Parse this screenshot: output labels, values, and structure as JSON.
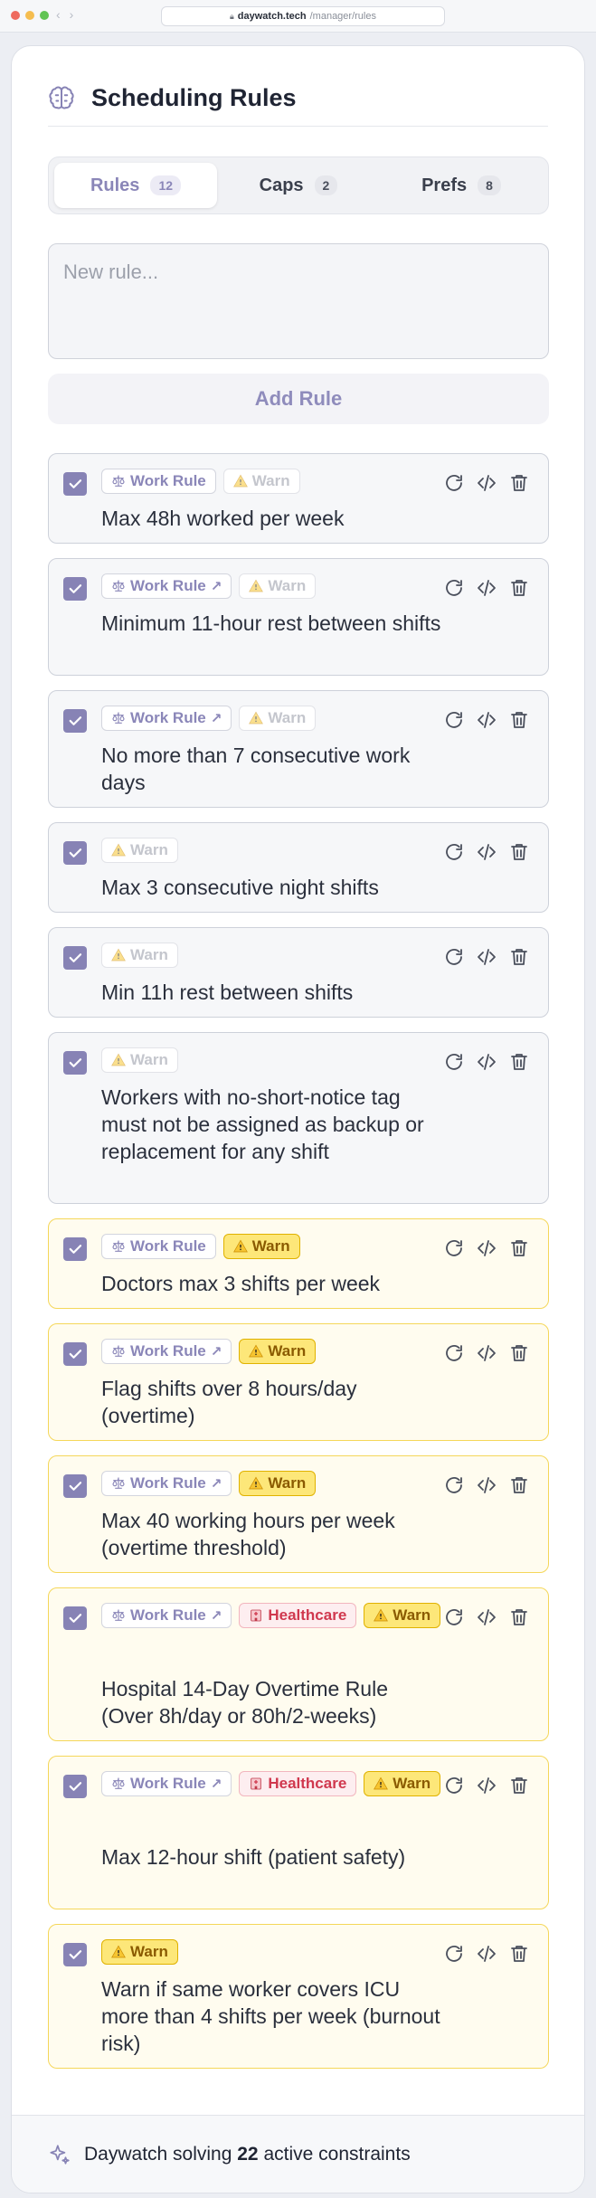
{
  "browser": {
    "domain": "daywatch.tech",
    "path": "/manager/rules"
  },
  "page": {
    "title": "Scheduling Rules",
    "icon": "brain-icon"
  },
  "tabs": [
    {
      "label": "Rules",
      "count": "12",
      "active": true
    },
    {
      "label": "Caps",
      "count": "2",
      "active": false
    },
    {
      "label": "Prefs",
      "count": "8",
      "active": false
    }
  ],
  "new_rule": {
    "placeholder": "New rule...",
    "add_label": "Add Rule"
  },
  "tag_labels": {
    "work": "Work Rule",
    "warn": "Warn",
    "health": "Healthcare"
  },
  "rules": [
    {
      "text": "Max 48h worked per week",
      "checked": true,
      "work": true,
      "ext": false,
      "health": false,
      "warn": "faint"
    },
    {
      "text": "Minimum 11-hour rest between shifts",
      "checked": true,
      "work": true,
      "ext": true,
      "health": false,
      "warn": "faint"
    },
    {
      "text": "No more than 7 consecutive work days",
      "checked": true,
      "work": true,
      "ext": true,
      "health": false,
      "warn": "faint"
    },
    {
      "text": "Max 3 consecutive night shifts",
      "checked": true,
      "work": false,
      "ext": false,
      "health": false,
      "warn": "faint"
    },
    {
      "text": "Min 11h rest between shifts",
      "checked": true,
      "work": false,
      "ext": false,
      "health": false,
      "warn": "faint"
    },
    {
      "text": "Workers with no-short-notice tag must not be assigned as backup or replacement for any shift",
      "checked": true,
      "work": false,
      "ext": false,
      "health": false,
      "warn": "faint"
    },
    {
      "text": "Doctors max 3 shifts per week",
      "checked": true,
      "work": true,
      "ext": false,
      "health": false,
      "warn": "strong"
    },
    {
      "text": "Flag shifts over 8 hours/day (overtime)",
      "checked": true,
      "work": true,
      "ext": true,
      "health": false,
      "warn": "strong"
    },
    {
      "text": "Max 40 working hours per week (overtime threshold)",
      "checked": true,
      "work": true,
      "ext": true,
      "health": false,
      "warn": "strong"
    },
    {
      "text": "Hospital 14-Day Overtime Rule (Over 8h/day or 80h/2-weeks)",
      "checked": true,
      "work": true,
      "ext": true,
      "health": true,
      "warn": "strong"
    },
    {
      "text": "Max 12-hour shift (patient safety)",
      "checked": true,
      "work": true,
      "ext": true,
      "health": true,
      "warn": "strong"
    },
    {
      "text": "Warn if same worker covers ICU more than 4 shifts per week (burnout risk)",
      "checked": true,
      "work": false,
      "ext": false,
      "health": false,
      "warn": "strong"
    }
  ],
  "footer": {
    "prefix": "Daywatch solving",
    "count": "22",
    "suffix": "active constraints"
  },
  "colors": {
    "accent": "#8783b5",
    "warn_border": "#f5d75a",
    "warn_bg": "#fffcef",
    "health": "#d0384e"
  }
}
